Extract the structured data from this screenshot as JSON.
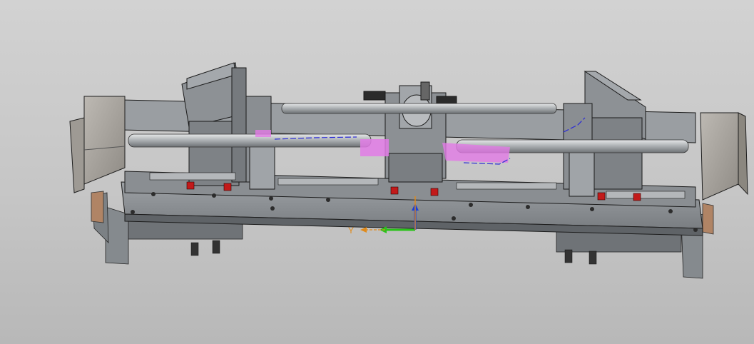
{
  "viewport": {
    "background_top": "#d2d2d2",
    "background_bottom": "#b8b8b8"
  },
  "model": {
    "body_color": "#8e9296",
    "body_dark": "#6f7377",
    "shaft_color": "#c9ccce",
    "motor_box_color": "#a7a39d",
    "bracket_color": "#b08465",
    "marker_red": "#c21a1a",
    "highlight_pink": "#e27be6",
    "selection_blue": "#2a2ad8"
  },
  "triad": {
    "x_color": "#e08a1a",
    "y_color": "#e08a1a",
    "y_label": "Y",
    "z_axis_color": "#1a3fd8",
    "green_axis_color": "#2ac21a"
  }
}
